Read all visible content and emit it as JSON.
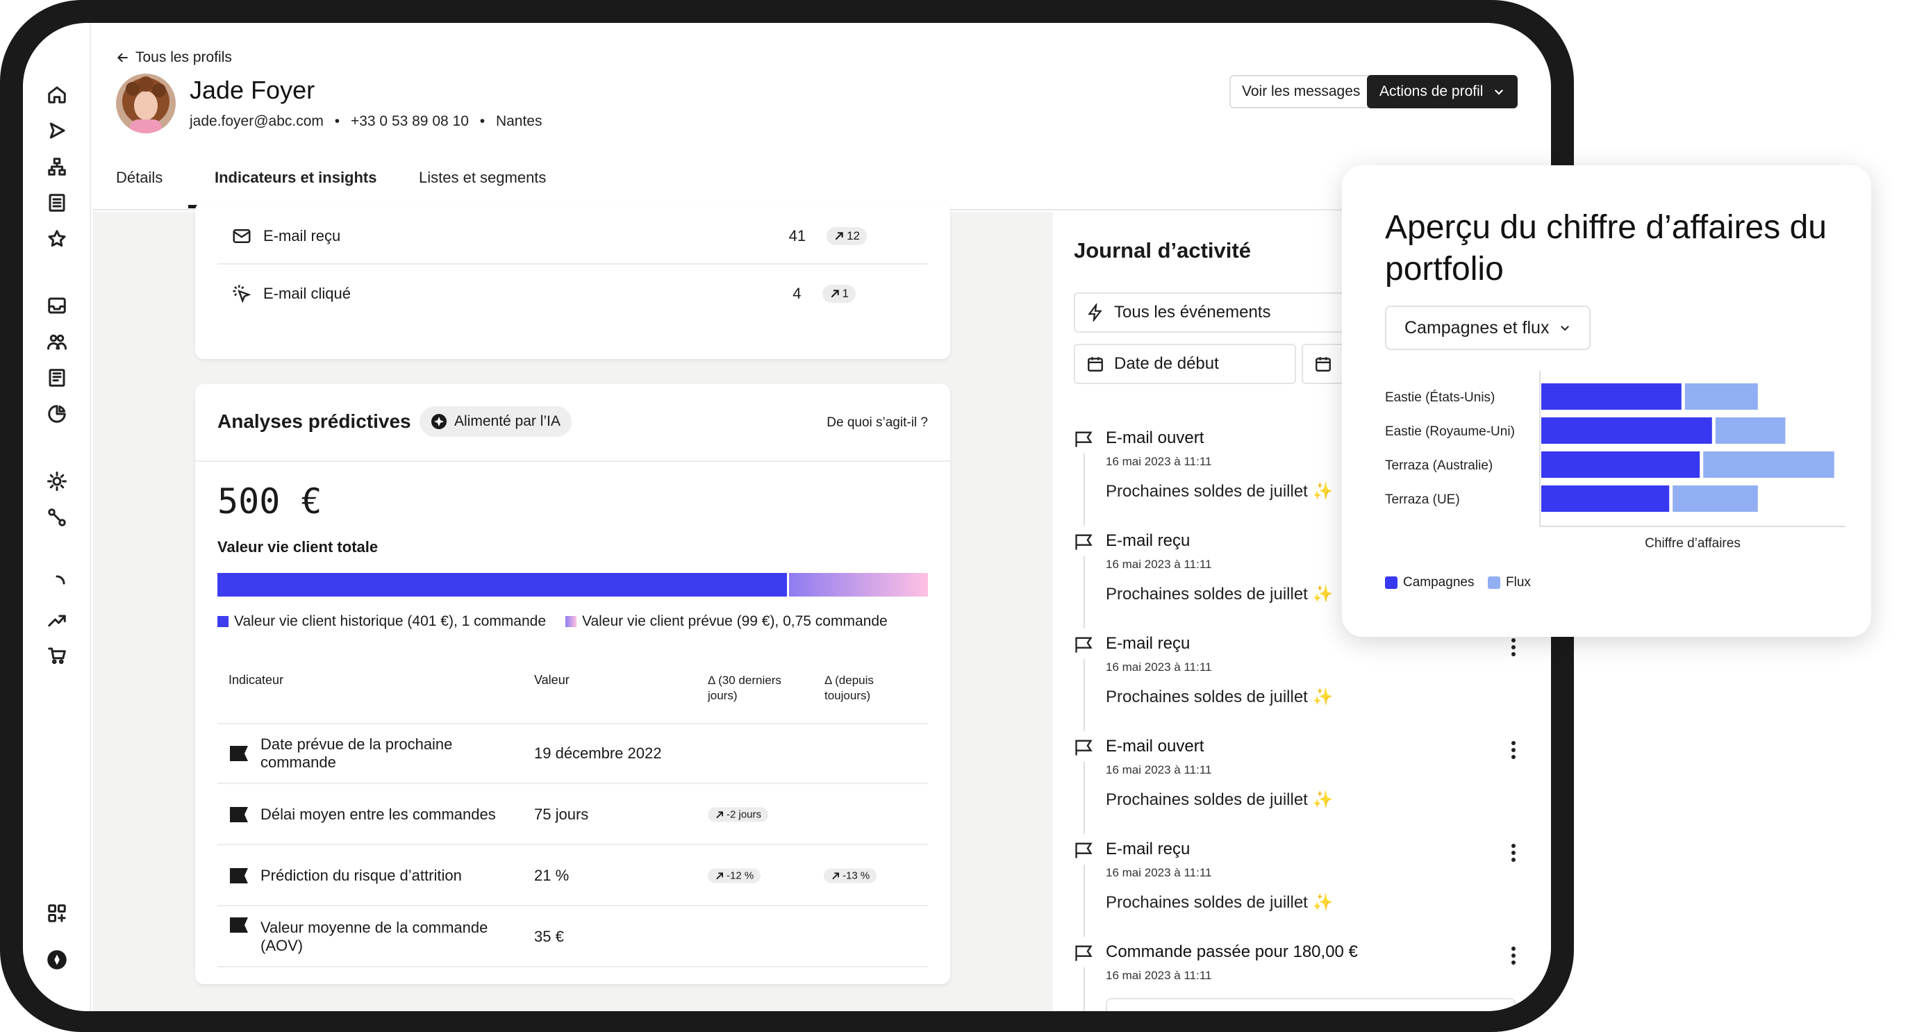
{
  "nav": {
    "back_label": "Tous les profils",
    "sidebar_icons": [
      "home-icon",
      "send-icon",
      "flow-icon",
      "list-icon",
      "star-icon",
      "inbox-icon",
      "audience-icon",
      "content-icon",
      "analytics-icon",
      "bulb-icon",
      "integration-icon",
      "loader-icon",
      "trend-icon",
      "cart-icon",
      "apps-icon",
      "account-icon"
    ]
  },
  "profile": {
    "name": "Jade Foyer",
    "email": "jade.foyer@abc.com",
    "phone": "+33 0 53 89 08 10",
    "city": "Nantes",
    "sep": "•",
    "messages_button": "Voir les messages",
    "actions_button": "Actions de profil"
  },
  "tabs": [
    {
      "label": "Détails",
      "active": false
    },
    {
      "label": "Indicateurs et insights",
      "active": true
    },
    {
      "label": "Listes et segments",
      "active": false
    }
  ],
  "email_metrics": [
    {
      "label": "E-mail reçu",
      "value": "41",
      "trend": "12",
      "icon": "mail-icon"
    },
    {
      "label": "E-mail cliqué",
      "value": "4",
      "trend": "1",
      "icon": "click-icon"
    }
  ],
  "predictive": {
    "title": "Analyses prédictives",
    "ai_badge": "Alimenté par l’IA",
    "help_link": "De quoi s’agit-il ?",
    "clv_amount": "500 €",
    "clv_label": "Valeur vie client totale",
    "historic_fraction": 0.802,
    "predicted_fraction": 0.198,
    "legend_historic": "Valeur vie client historique (401 €), 1 commande",
    "legend_predicted": "Valeur vie client prévue (99 €), 0,75 commande",
    "colors": {
      "historic": "#3d3df0",
      "predicted_start": "#8f7cf0",
      "predicted_end": "#ffc1e3"
    },
    "table_headers": {
      "indicator": "Indicateur",
      "value": "Valeur",
      "d30": "Δ (30 derniers jours)",
      "dall": "Δ (depuis toujours)"
    },
    "rows": [
      {
        "label": "Date prévue de la prochaine commande",
        "value": "19 décembre 2022",
        "d30": "",
        "dall": ""
      },
      {
        "label": "Délai moyen entre les commandes",
        "value": "75 jours",
        "d30": "-2 jours",
        "dall": ""
      },
      {
        "label": "Prédiction du risque d’attrition",
        "value": "21 %",
        "d30": "-12 %",
        "dall": "-13 %"
      },
      {
        "label": "Valeur moyenne de la commande (AOV)",
        "value": "35 €",
        "d30": "",
        "dall": ""
      }
    ]
  },
  "activity": {
    "title": "Journal d’activité",
    "filter_events": "Tous les événements",
    "filter_start": "Date de début",
    "items": [
      {
        "title": "E-mail ouvert",
        "date": "16 mai 2023 à 11:11",
        "body": "Prochaines soldes de juillet ✨"
      },
      {
        "title": "E-mail reçu",
        "date": "16 mai 2023 à 11:11",
        "body": "Prochaines soldes de juillet ✨"
      },
      {
        "title": "E-mail reçu",
        "date": "16 mai 2023 à 11:11",
        "body": "Prochaines soldes de juillet ✨"
      },
      {
        "title": "E-mail ouvert",
        "date": "16 mai 2023 à 11:11",
        "body": "Prochaines soldes de juillet ✨"
      },
      {
        "title": "E-mail reçu",
        "date": "16 mai 2023 à 11:11",
        "body": "Prochaines soldes de juillet ✨"
      },
      {
        "title": "Commande passée pour 180,00 €",
        "date": "16 mai 2023 à 11:11",
        "body": ""
      }
    ]
  },
  "popup": {
    "title": "Aperçu du chiffre d’affaires du portfolio",
    "dropdown": "Campagnes et flux"
  },
  "chart_data": {
    "type": "bar",
    "orientation": "horizontal",
    "stacked": true,
    "categories": [
      "Eastie (États-Unis)",
      "Eastie (Royaume-Uni)",
      "Terraza (Australie)",
      "Terraza (UE)"
    ],
    "series": [
      {
        "name": "Campagnes",
        "values": [
          47,
          57,
          53,
          43
        ],
        "color": "#3838f0"
      },
      {
        "name": "Flux",
        "values": [
          25,
          24,
          44,
          29
        ],
        "color": "#93aff3"
      }
    ],
    "xlabel": "Chiffre d’affaires",
    "ylabel": "",
    "xlim": [
      0,
      100
    ],
    "grid": false,
    "legend": "bottom-left"
  }
}
